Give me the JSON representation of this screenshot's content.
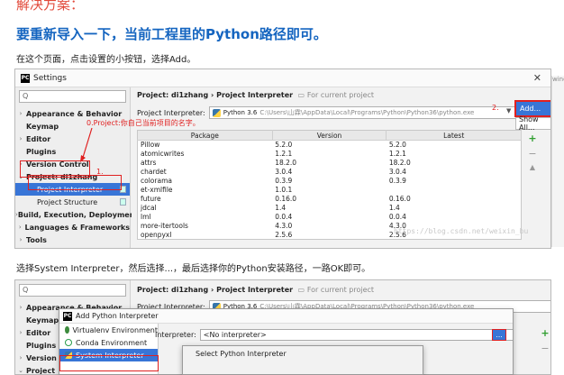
{
  "article": {
    "heading_red": "解决方案：",
    "heading_blue": "要重新导入一下，当前工程里的Python路径即可。",
    "instruction_1": "在这个页面，点击设置的小按钮，选择Add。",
    "instruction_2": "选择System Interpreter，然后选择...，最后选择你的Python安装路径，一路OK即可。",
    "watermark": "https://blog.csdn.net/weixin_bu"
  },
  "settings": {
    "window_title": "Settings",
    "search_placeholder": "Q",
    "sidebar": {
      "appearance": "Appearance & Behavior",
      "keymap": "Keymap",
      "editor": "Editor",
      "plugins": "Plugins",
      "version_control": "Version Control",
      "project": "Project: di1zhang",
      "project_interpreter": "Project Interpreter",
      "project_structure": "Project Structure",
      "build": "Build, Execution, Deployment",
      "languages": "Languages & Frameworks",
      "tools": "Tools"
    },
    "breadcrumb": {
      "project": "Project: di1zhang",
      "sep": "›",
      "page": "Project Interpreter",
      "scope": "For current project"
    },
    "interpreter_label": "Project Interpreter:",
    "interpreter_value": "Python 3.6",
    "interpreter_path": "C:\\Users\\山霖\\AppData\\Local\\Programs\\Python\\Python36\\python.exe",
    "menu": {
      "add": "Add...",
      "show_all": "Show All..."
    },
    "annotations": {
      "project_hint": "0.Project:你自己当前项目的名字。",
      "step1": "1.",
      "step2": "2."
    },
    "table": {
      "headers": [
        "Package",
        "Version",
        "Latest"
      ],
      "rows": [
        [
          "Pillow",
          "5.2.0",
          "5.2.0"
        ],
        [
          "atomicwrites",
          "1.2.1",
          "1.2.1"
        ],
        [
          "attrs",
          "18.2.0",
          "18.2.0"
        ],
        [
          "chardet",
          "3.0.4",
          "3.0.4"
        ],
        [
          "colorama",
          "0.3.9",
          "0.3.9"
        ],
        [
          "et-xmlfile",
          "1.0.1",
          ""
        ],
        [
          "future",
          "0.16.0",
          "0.16.0"
        ],
        [
          "jdcal",
          "1.4",
          "1.4"
        ],
        [
          "lml",
          "0.0.4",
          "0.0.4"
        ],
        [
          "more-itertools",
          "4.3.0",
          "4.3.0"
        ],
        [
          "openpyxl",
          "2.5.6",
          "2.5.6"
        ]
      ]
    },
    "tools": {
      "add": "+",
      "remove": "−",
      "up": "▲"
    },
    "right_fragment": "windo"
  },
  "settings2": {
    "sidebar": {
      "appearance": "Appearance & Behavior",
      "keymap": "Keymap",
      "editor": "Editor",
      "plugins": "Plugins",
      "version_control": "Version Co",
      "project": "Project"
    },
    "breadcrumb": {
      "project": "Project: di1zhang",
      "sep": "›",
      "page": "Project Interpreter",
      "scope": "For current project"
    },
    "interpreter_label": "Project Interpreter:",
    "interpreter_value": "Python 3.6",
    "interpreter_path": "C:\\Users\\山霖\\AppData\\Local\\Programs\\Python\\Python36\\python.exe"
  },
  "add_dialog": {
    "title": "Add Python Interpreter",
    "envs": [
      "Virtualenv Environment",
      "Conda Environment",
      "System Interpreter"
    ],
    "interpreter_label": "Interpreter:",
    "interpreter_value": "<No interpreter>",
    "browse": "..."
  },
  "select_dialog": {
    "title": "Select Python Interpreter"
  }
}
